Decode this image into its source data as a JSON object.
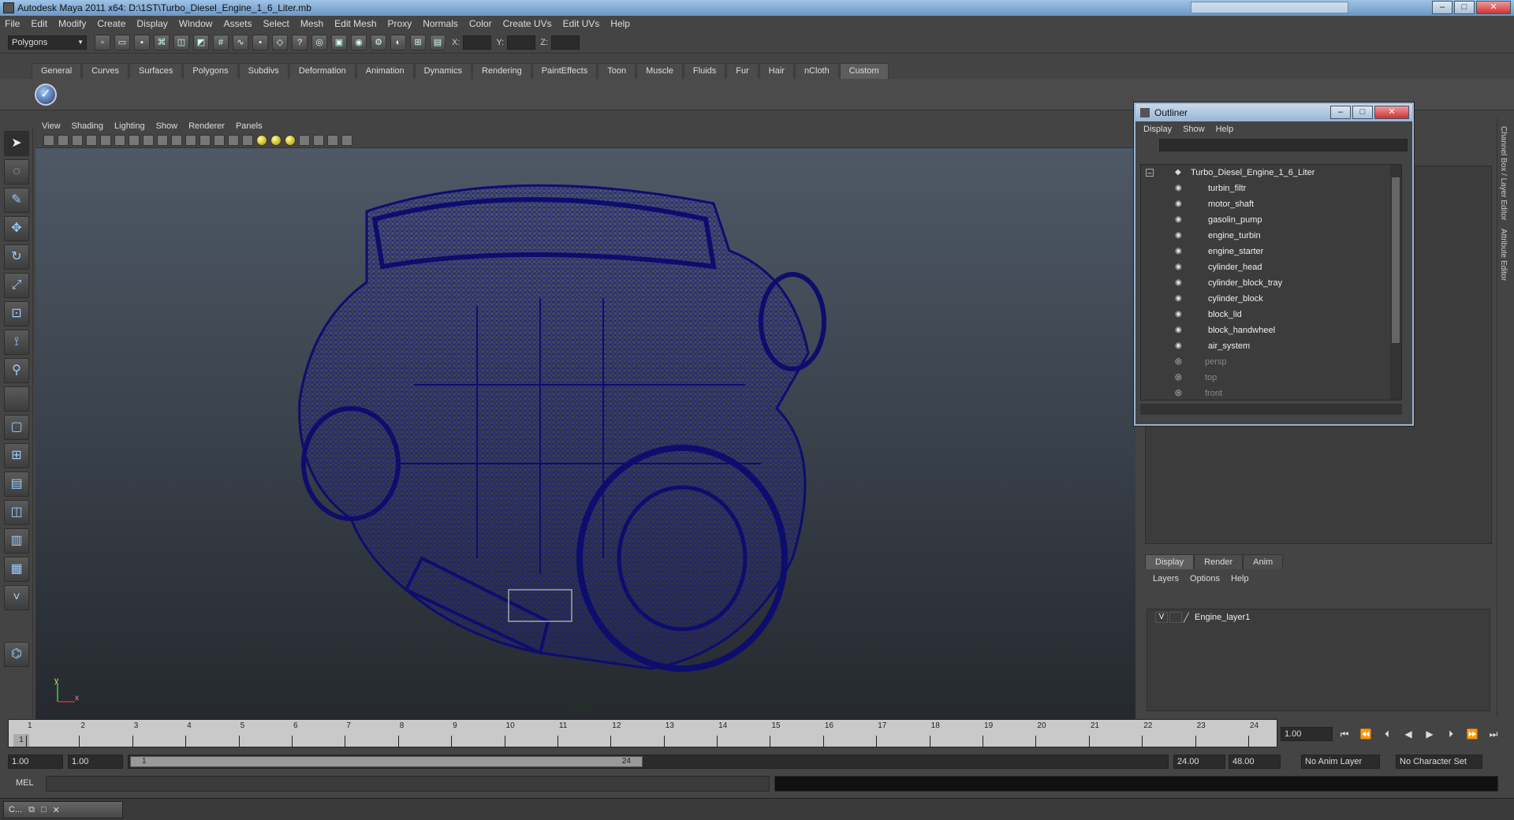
{
  "window": {
    "title": "Autodesk Maya 2011 x64: D:\\1ST\\Turbo_Diesel_Engine_1_6_Liter.mb",
    "minimize": "–",
    "maximize": "□",
    "close": "✕"
  },
  "menubar": [
    "File",
    "Edit",
    "Modify",
    "Create",
    "Display",
    "Window",
    "Assets",
    "Select",
    "Mesh",
    "Edit Mesh",
    "Proxy",
    "Normals",
    "Color",
    "Create UVs",
    "Edit UVs",
    "Help"
  ],
  "statusline": {
    "mode": "Polygons",
    "x_label": "X:",
    "y_label": "Y:",
    "z_label": "Z:"
  },
  "shelf_tabs": [
    "General",
    "Curves",
    "Surfaces",
    "Polygons",
    "Subdivs",
    "Deformation",
    "Animation",
    "Dynamics",
    "Rendering",
    "PaintEffects",
    "Toon",
    "Muscle",
    "Fluids",
    "Fur",
    "Hair",
    "nCloth",
    "Custom"
  ],
  "active_shelf_tab": "Custom",
  "viewport": {
    "menu": [
      "View",
      "Shading",
      "Lighting",
      "Show",
      "Renderer",
      "Panels"
    ],
    "camera_label": "persp",
    "axis_y": "y",
    "axis_x": "x",
    "wire_color": "#0d0d6e"
  },
  "outliner": {
    "title": "Outliner",
    "menu": [
      "Display",
      "Show",
      "Help"
    ],
    "root": "Turbo_Diesel_Engine_1_6_Liter",
    "children": [
      "turbin_filtr",
      "motor_shaft",
      "gasolin_pump",
      "engine_turbin",
      "engine_starter",
      "cylinder_head",
      "cylinder_block_tray",
      "cylinder_block",
      "block_lid",
      "block_handwheel",
      "air_system"
    ],
    "cameras": [
      "persp",
      "top",
      "front"
    ]
  },
  "layer_editor": {
    "tabs": [
      "Display",
      "Render",
      "Anim"
    ],
    "active_tab": "Display",
    "menu": [
      "Layers",
      "Options",
      "Help"
    ],
    "layer_visible": "V",
    "layer_name": "Engine_layer1"
  },
  "side_tabs": [
    "Channel Box / Layer Editor",
    "Attribute Editor"
  ],
  "timeline": {
    "ticks": [
      "1",
      "2",
      "3",
      "4",
      "5",
      "6",
      "7",
      "8",
      "9",
      "10",
      "11",
      "12",
      "13",
      "14",
      "15",
      "16",
      "17",
      "18",
      "19",
      "20",
      "21",
      "22",
      "23",
      "24"
    ],
    "current_frame": "1",
    "current_time_field": "1.00"
  },
  "range": {
    "start": "1.00",
    "start2": "1.00",
    "bar_start": "1",
    "bar_end": "24",
    "end": "24.00",
    "end2": "48.00",
    "anim_layer": "No Anim Layer",
    "char_set": "No Character Set"
  },
  "cmdline": {
    "label": "MEL"
  },
  "taskbar": {
    "item": "C..."
  }
}
